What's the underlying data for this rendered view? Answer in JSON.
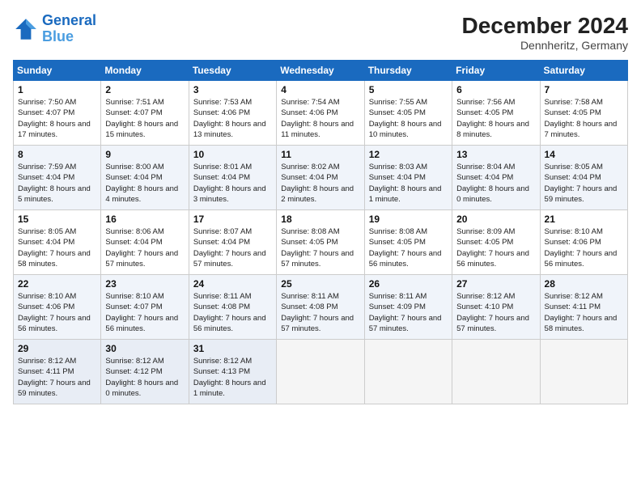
{
  "header": {
    "logo_line1": "General",
    "logo_line2": "Blue",
    "month": "December 2024",
    "location": "Dennheritz, Germany"
  },
  "weekdays": [
    "Sunday",
    "Monday",
    "Tuesday",
    "Wednesday",
    "Thursday",
    "Friday",
    "Saturday"
  ],
  "weeks": [
    [
      {
        "day": "1",
        "sunrise": "Sunrise: 7:50 AM",
        "sunset": "Sunset: 4:07 PM",
        "daylight": "Daylight: 8 hours and 17 minutes."
      },
      {
        "day": "2",
        "sunrise": "Sunrise: 7:51 AM",
        "sunset": "Sunset: 4:07 PM",
        "daylight": "Daylight: 8 hours and 15 minutes."
      },
      {
        "day": "3",
        "sunrise": "Sunrise: 7:53 AM",
        "sunset": "Sunset: 4:06 PM",
        "daylight": "Daylight: 8 hours and 13 minutes."
      },
      {
        "day": "4",
        "sunrise": "Sunrise: 7:54 AM",
        "sunset": "Sunset: 4:06 PM",
        "daylight": "Daylight: 8 hours and 11 minutes."
      },
      {
        "day": "5",
        "sunrise": "Sunrise: 7:55 AM",
        "sunset": "Sunset: 4:05 PM",
        "daylight": "Daylight: 8 hours and 10 minutes."
      },
      {
        "day": "6",
        "sunrise": "Sunrise: 7:56 AM",
        "sunset": "Sunset: 4:05 PM",
        "daylight": "Daylight: 8 hours and 8 minutes."
      },
      {
        "day": "7",
        "sunrise": "Sunrise: 7:58 AM",
        "sunset": "Sunset: 4:05 PM",
        "daylight": "Daylight: 8 hours and 7 minutes."
      }
    ],
    [
      {
        "day": "8",
        "sunrise": "Sunrise: 7:59 AM",
        "sunset": "Sunset: 4:04 PM",
        "daylight": "Daylight: 8 hours and 5 minutes."
      },
      {
        "day": "9",
        "sunrise": "Sunrise: 8:00 AM",
        "sunset": "Sunset: 4:04 PM",
        "daylight": "Daylight: 8 hours and 4 minutes."
      },
      {
        "day": "10",
        "sunrise": "Sunrise: 8:01 AM",
        "sunset": "Sunset: 4:04 PM",
        "daylight": "Daylight: 8 hours and 3 minutes."
      },
      {
        "day": "11",
        "sunrise": "Sunrise: 8:02 AM",
        "sunset": "Sunset: 4:04 PM",
        "daylight": "Daylight: 8 hours and 2 minutes."
      },
      {
        "day": "12",
        "sunrise": "Sunrise: 8:03 AM",
        "sunset": "Sunset: 4:04 PM",
        "daylight": "Daylight: 8 hours and 1 minute."
      },
      {
        "day": "13",
        "sunrise": "Sunrise: 8:04 AM",
        "sunset": "Sunset: 4:04 PM",
        "daylight": "Daylight: 8 hours and 0 minutes."
      },
      {
        "day": "14",
        "sunrise": "Sunrise: 8:05 AM",
        "sunset": "Sunset: 4:04 PM",
        "daylight": "Daylight: 7 hours and 59 minutes."
      }
    ],
    [
      {
        "day": "15",
        "sunrise": "Sunrise: 8:05 AM",
        "sunset": "Sunset: 4:04 PM",
        "daylight": "Daylight: 7 hours and 58 minutes."
      },
      {
        "day": "16",
        "sunrise": "Sunrise: 8:06 AM",
        "sunset": "Sunset: 4:04 PM",
        "daylight": "Daylight: 7 hours and 57 minutes."
      },
      {
        "day": "17",
        "sunrise": "Sunrise: 8:07 AM",
        "sunset": "Sunset: 4:04 PM",
        "daylight": "Daylight: 7 hours and 57 minutes."
      },
      {
        "day": "18",
        "sunrise": "Sunrise: 8:08 AM",
        "sunset": "Sunset: 4:05 PM",
        "daylight": "Daylight: 7 hours and 57 minutes."
      },
      {
        "day": "19",
        "sunrise": "Sunrise: 8:08 AM",
        "sunset": "Sunset: 4:05 PM",
        "daylight": "Daylight: 7 hours and 56 minutes."
      },
      {
        "day": "20",
        "sunrise": "Sunrise: 8:09 AM",
        "sunset": "Sunset: 4:05 PM",
        "daylight": "Daylight: 7 hours and 56 minutes."
      },
      {
        "day": "21",
        "sunrise": "Sunrise: 8:10 AM",
        "sunset": "Sunset: 4:06 PM",
        "daylight": "Daylight: 7 hours and 56 minutes."
      }
    ],
    [
      {
        "day": "22",
        "sunrise": "Sunrise: 8:10 AM",
        "sunset": "Sunset: 4:06 PM",
        "daylight": "Daylight: 7 hours and 56 minutes."
      },
      {
        "day": "23",
        "sunrise": "Sunrise: 8:10 AM",
        "sunset": "Sunset: 4:07 PM",
        "daylight": "Daylight: 7 hours and 56 minutes."
      },
      {
        "day": "24",
        "sunrise": "Sunrise: 8:11 AM",
        "sunset": "Sunset: 4:08 PM",
        "daylight": "Daylight: 7 hours and 56 minutes."
      },
      {
        "day": "25",
        "sunrise": "Sunrise: 8:11 AM",
        "sunset": "Sunset: 4:08 PM",
        "daylight": "Daylight: 7 hours and 57 minutes."
      },
      {
        "day": "26",
        "sunrise": "Sunrise: 8:11 AM",
        "sunset": "Sunset: 4:09 PM",
        "daylight": "Daylight: 7 hours and 57 minutes."
      },
      {
        "day": "27",
        "sunrise": "Sunrise: 8:12 AM",
        "sunset": "Sunset: 4:10 PM",
        "daylight": "Daylight: 7 hours and 57 minutes."
      },
      {
        "day": "28",
        "sunrise": "Sunrise: 8:12 AM",
        "sunset": "Sunset: 4:11 PM",
        "daylight": "Daylight: 7 hours and 58 minutes."
      }
    ],
    [
      {
        "day": "29",
        "sunrise": "Sunrise: 8:12 AM",
        "sunset": "Sunset: 4:11 PM",
        "daylight": "Daylight: 7 hours and 59 minutes."
      },
      {
        "day": "30",
        "sunrise": "Sunrise: 8:12 AM",
        "sunset": "Sunset: 4:12 PM",
        "daylight": "Daylight: 8 hours and 0 minutes."
      },
      {
        "day": "31",
        "sunrise": "Sunrise: 8:12 AM",
        "sunset": "Sunset: 4:13 PM",
        "daylight": "Daylight: 8 hours and 1 minute."
      },
      null,
      null,
      null,
      null
    ]
  ]
}
